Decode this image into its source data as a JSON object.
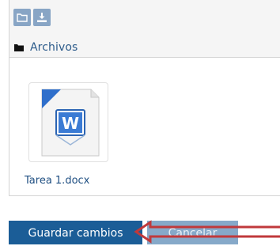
{
  "filemanager": {
    "path_label": "Archivos",
    "files": [
      {
        "name": "Tarea 1.docx",
        "icon": "word-document-icon"
      }
    ]
  },
  "actions": {
    "save_label": "Guardar cambios",
    "cancel_label": "Cancelar"
  },
  "colors": {
    "primary": "#1b5d97",
    "secondary": "#86a9c9",
    "link": "#2b5a8a",
    "annotation": "#c0393b"
  },
  "annotation": {
    "icon": "red-arrow-icon"
  }
}
